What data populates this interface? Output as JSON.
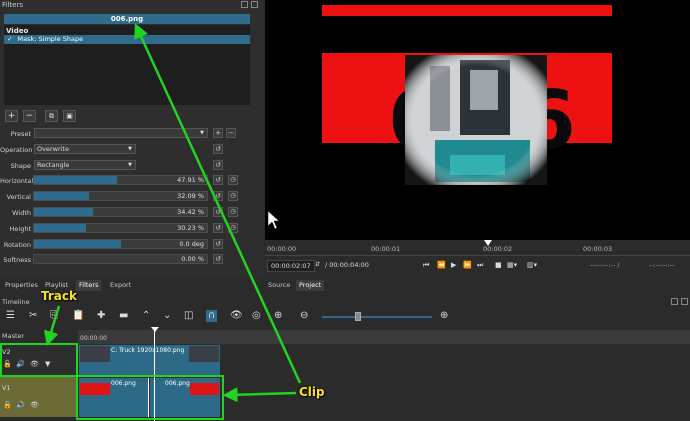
{
  "filters": {
    "title": "Filters",
    "clip_name": "006.png",
    "category": "Video",
    "items": [
      {
        "label": "Mask: Simple Shape",
        "checked": true
      }
    ],
    "buttons": {
      "add": "+",
      "remove": "−",
      "copy": "⧉",
      "save": "▣"
    },
    "preset_label": "Preset",
    "operation": {
      "label": "Operation",
      "value": "Overwrite"
    },
    "shape": {
      "label": "Shape",
      "value": "Rectangle"
    },
    "params": [
      {
        "label": "Horizontal",
        "value": "47.91 %",
        "fraction": 0.479
      },
      {
        "label": "Vertical",
        "value": "32.09 %",
        "fraction": 0.321
      },
      {
        "label": "Width",
        "value": "34.42 %",
        "fraction": 0.344
      },
      {
        "label": "Height",
        "value": "30.23 %",
        "fraction": 0.302
      },
      {
        "label": "Rotation",
        "value": "0.0 deg",
        "fraction": 0.5
      },
      {
        "label": "Softness",
        "value": "0.00 %",
        "fraction": 0.0
      }
    ]
  },
  "left_tabs": [
    "Properties",
    "Playlist",
    "Filters",
    "Export"
  ],
  "viewer": {
    "ruler": [
      "00:00:00",
      "00:00:01",
      "00:00:02",
      "00:00:03"
    ],
    "position": "00:00:02:07",
    "duration": "/ 00:00:04:00",
    "in_point": "--:--:--:-- /",
    "out_point": "--:--:--:--",
    "tabs": [
      "Source",
      "Project"
    ]
  },
  "timeline": {
    "title": "Timeline",
    "master": "Master",
    "ruler_start": "00:00:00",
    "tracks": [
      {
        "name": "V2",
        "clip": "C: Truck 1920x1080.png"
      },
      {
        "name": "V1",
        "clip_a": "006.png",
        "clip_b": "006.png"
      }
    ]
  },
  "annotations": {
    "track": "Track",
    "clip": "Clip",
    "color": "#22d322"
  }
}
